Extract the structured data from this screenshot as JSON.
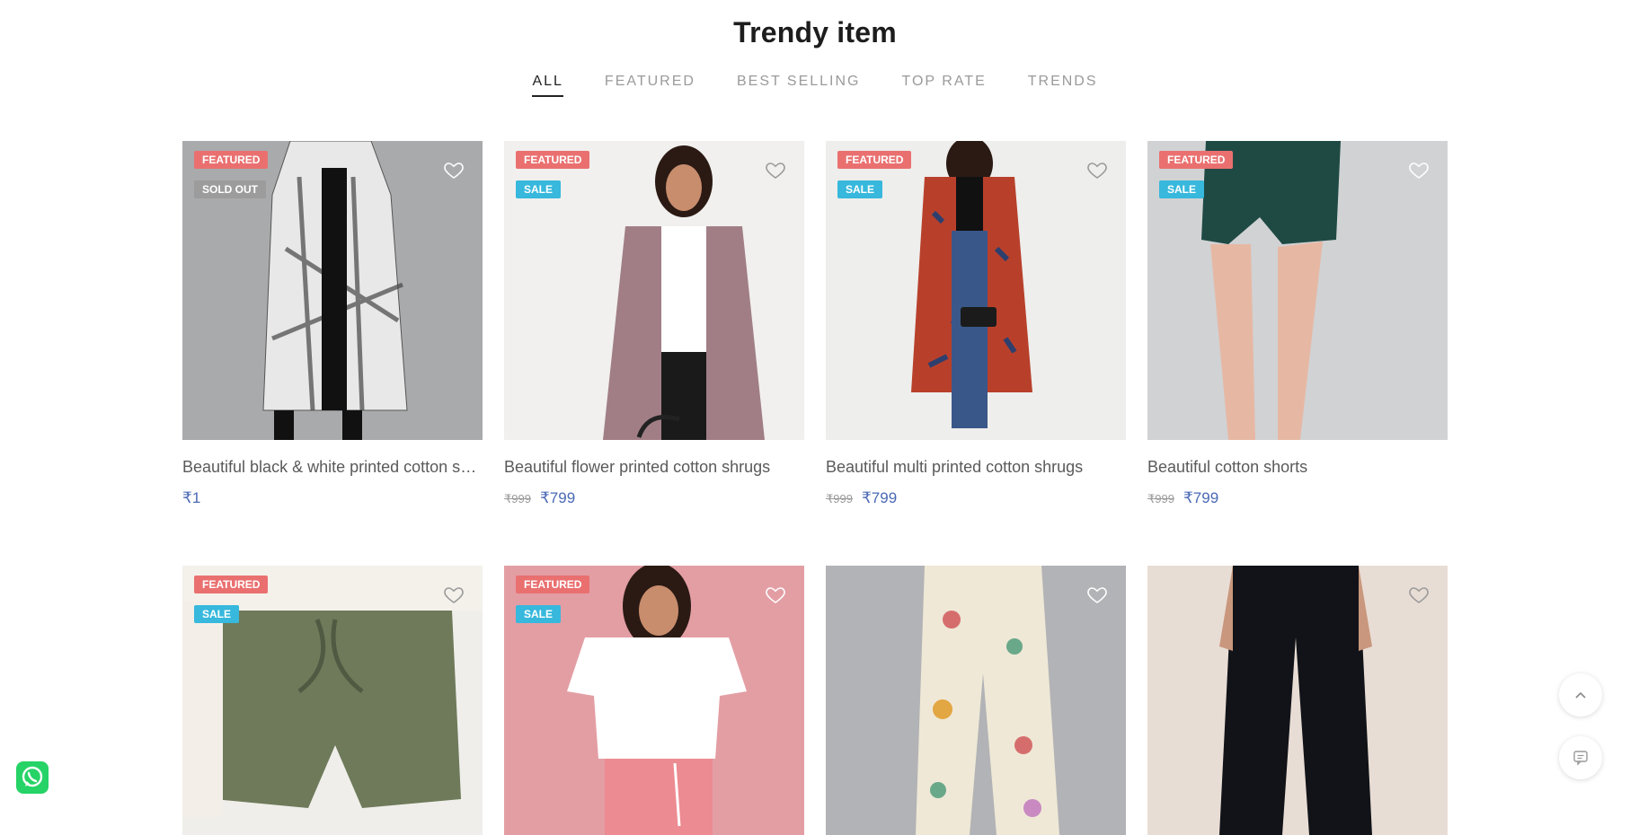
{
  "section": {
    "title": "Trendy item"
  },
  "tabs": [
    {
      "label": "ALL",
      "active": true
    },
    {
      "label": "FEATURED",
      "active": false
    },
    {
      "label": "BEST SELLING",
      "active": false
    },
    {
      "label": "TOP RATE",
      "active": false
    },
    {
      "label": "TRENDS",
      "active": false
    }
  ],
  "products": [
    {
      "name": "Beautiful black & white printed cotton shrugs",
      "badges": [
        "FEATURED",
        "SOLD OUT"
      ],
      "old_price": "",
      "price": "₹1"
    },
    {
      "name": "Beautiful flower printed cotton shrugs",
      "badges": [
        "FEATURED",
        "SALE"
      ],
      "old_price": "₹999",
      "price": "₹799"
    },
    {
      "name": "Beautiful multi printed cotton shrugs",
      "badges": [
        "FEATURED",
        "SALE"
      ],
      "old_price": "₹999",
      "price": "₹799"
    },
    {
      "name": "Beautiful cotton shorts",
      "badges": [
        "FEATURED",
        "SALE"
      ],
      "old_price": "₹999",
      "price": "₹799"
    },
    {
      "name": "",
      "badges": [
        "FEATURED",
        "SALE"
      ],
      "old_price": "",
      "price": ""
    },
    {
      "name": "",
      "badges": [
        "FEATURED",
        "SALE"
      ],
      "old_price": "",
      "price": ""
    },
    {
      "name": "",
      "badges": [],
      "old_price": "",
      "price": ""
    },
    {
      "name": "",
      "badges": [],
      "old_price": "",
      "price": ""
    }
  ],
  "icons": {
    "wishlist": "heart-outline-icon",
    "whatsapp": "whatsapp-icon",
    "scroll_top": "chevron-up-icon",
    "chat": "chat-icon"
  },
  "colors": {
    "featured_badge": "#ea7070",
    "sale_badge": "#37b8dc",
    "soldout_badge": "#9c9c9c",
    "price": "#4a69b4",
    "whatsapp": "#25d366"
  }
}
